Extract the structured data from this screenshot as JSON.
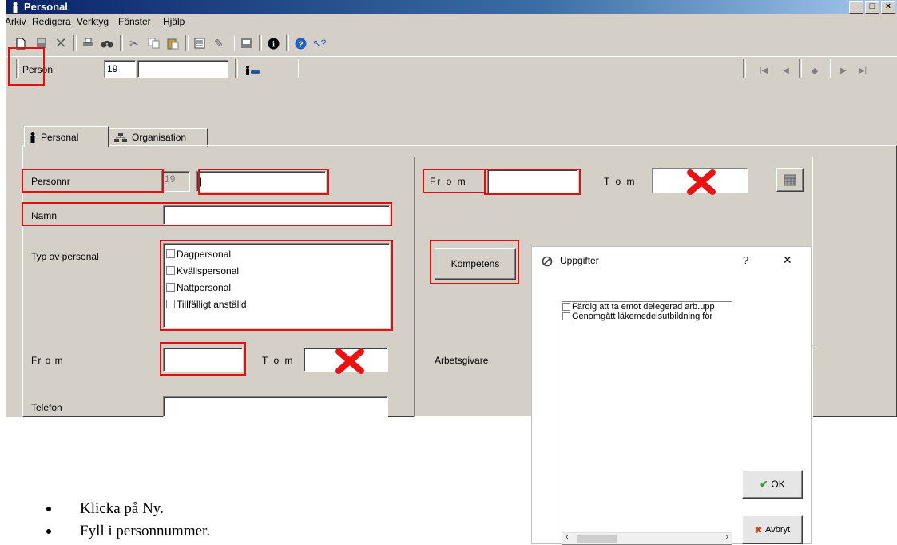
{
  "window": {
    "title": "Personal"
  },
  "menu": [
    "Arkiv",
    "Redigera",
    "Verktyg",
    "Fönster",
    "Hjälp"
  ],
  "toolbar": {
    "icons": [
      "new-icon",
      "save-icon",
      "delete-icon",
      "print-icon",
      "find-icon",
      "cut-icon",
      "copy-icon",
      "paste-icon",
      "list-icon",
      "tool-icon",
      "report-icon",
      "info-icon",
      "help-icon",
      "whats-this-icon"
    ]
  },
  "navbar": {
    "person_label": "Person",
    "person_id": "19",
    "person_name": ""
  },
  "tabs": [
    {
      "label": "Personal"
    },
    {
      "label": "Organisation"
    }
  ],
  "form": {
    "personnr_label": "Personnr",
    "personnr_prefix": "19",
    "personnr_value": "|",
    "namn_label": "Namn",
    "typ_label": "Typ av personal",
    "typ_options": [
      "Dagpersonal",
      "Kvällspersonal",
      "Nattpersonal",
      "Tillfälligt anställd"
    ],
    "from_label": "Fr o m",
    "tom_label": "T o m",
    "telefon_label": "Telefon",
    "right_from_label": "Fr o m",
    "right_tom_label": "T o m",
    "kompetens_button": "Kompetens",
    "arbetsgivare_label": "Arbetsgivare"
  },
  "dialog": {
    "title": "Uppgifter",
    "help": "?",
    "close": "✕",
    "items": [
      "Färdig att ta emot delegerad arb.upp",
      "Genomgått läkemedelsutbildning för"
    ],
    "ok_button": "OK",
    "cancel_button": "Avbryt"
  },
  "instructions": [
    "Klicka på Ny.",
    "Fyll i personnummer."
  ],
  "colors": {
    "highlight": "#e01010",
    "titlebar": "#0a246a",
    "window_bg": "#d4d0c8"
  }
}
